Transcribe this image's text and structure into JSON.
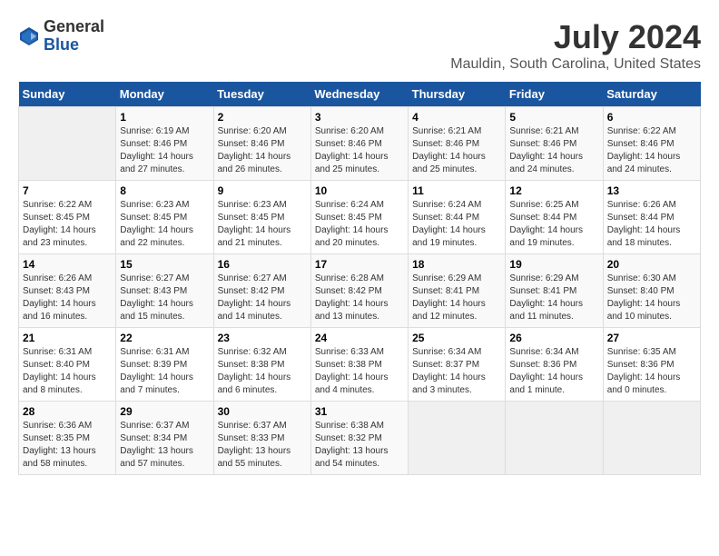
{
  "logo": {
    "general": "General",
    "blue": "Blue"
  },
  "title": "July 2024",
  "location": "Mauldin, South Carolina, United States",
  "days_of_week": [
    "Sunday",
    "Monday",
    "Tuesday",
    "Wednesday",
    "Thursday",
    "Friday",
    "Saturday"
  ],
  "weeks": [
    [
      {
        "day": "",
        "info": ""
      },
      {
        "day": "1",
        "info": "Sunrise: 6:19 AM\nSunset: 8:46 PM\nDaylight: 14 hours\nand 27 minutes."
      },
      {
        "day": "2",
        "info": "Sunrise: 6:20 AM\nSunset: 8:46 PM\nDaylight: 14 hours\nand 26 minutes."
      },
      {
        "day": "3",
        "info": "Sunrise: 6:20 AM\nSunset: 8:46 PM\nDaylight: 14 hours\nand 25 minutes."
      },
      {
        "day": "4",
        "info": "Sunrise: 6:21 AM\nSunset: 8:46 PM\nDaylight: 14 hours\nand 25 minutes."
      },
      {
        "day": "5",
        "info": "Sunrise: 6:21 AM\nSunset: 8:46 PM\nDaylight: 14 hours\nand 24 minutes."
      },
      {
        "day": "6",
        "info": "Sunrise: 6:22 AM\nSunset: 8:46 PM\nDaylight: 14 hours\nand 24 minutes."
      }
    ],
    [
      {
        "day": "7",
        "info": "Sunrise: 6:22 AM\nSunset: 8:45 PM\nDaylight: 14 hours\nand 23 minutes."
      },
      {
        "day": "8",
        "info": "Sunrise: 6:23 AM\nSunset: 8:45 PM\nDaylight: 14 hours\nand 22 minutes."
      },
      {
        "day": "9",
        "info": "Sunrise: 6:23 AM\nSunset: 8:45 PM\nDaylight: 14 hours\nand 21 minutes."
      },
      {
        "day": "10",
        "info": "Sunrise: 6:24 AM\nSunset: 8:45 PM\nDaylight: 14 hours\nand 20 minutes."
      },
      {
        "day": "11",
        "info": "Sunrise: 6:24 AM\nSunset: 8:44 PM\nDaylight: 14 hours\nand 19 minutes."
      },
      {
        "day": "12",
        "info": "Sunrise: 6:25 AM\nSunset: 8:44 PM\nDaylight: 14 hours\nand 19 minutes."
      },
      {
        "day": "13",
        "info": "Sunrise: 6:26 AM\nSunset: 8:44 PM\nDaylight: 14 hours\nand 18 minutes."
      }
    ],
    [
      {
        "day": "14",
        "info": "Sunrise: 6:26 AM\nSunset: 8:43 PM\nDaylight: 14 hours\nand 16 minutes."
      },
      {
        "day": "15",
        "info": "Sunrise: 6:27 AM\nSunset: 8:43 PM\nDaylight: 14 hours\nand 15 minutes."
      },
      {
        "day": "16",
        "info": "Sunrise: 6:27 AM\nSunset: 8:42 PM\nDaylight: 14 hours\nand 14 minutes."
      },
      {
        "day": "17",
        "info": "Sunrise: 6:28 AM\nSunset: 8:42 PM\nDaylight: 14 hours\nand 13 minutes."
      },
      {
        "day": "18",
        "info": "Sunrise: 6:29 AM\nSunset: 8:41 PM\nDaylight: 14 hours\nand 12 minutes."
      },
      {
        "day": "19",
        "info": "Sunrise: 6:29 AM\nSunset: 8:41 PM\nDaylight: 14 hours\nand 11 minutes."
      },
      {
        "day": "20",
        "info": "Sunrise: 6:30 AM\nSunset: 8:40 PM\nDaylight: 14 hours\nand 10 minutes."
      }
    ],
    [
      {
        "day": "21",
        "info": "Sunrise: 6:31 AM\nSunset: 8:40 PM\nDaylight: 14 hours\nand 8 minutes."
      },
      {
        "day": "22",
        "info": "Sunrise: 6:31 AM\nSunset: 8:39 PM\nDaylight: 14 hours\nand 7 minutes."
      },
      {
        "day": "23",
        "info": "Sunrise: 6:32 AM\nSunset: 8:38 PM\nDaylight: 14 hours\nand 6 minutes."
      },
      {
        "day": "24",
        "info": "Sunrise: 6:33 AM\nSunset: 8:38 PM\nDaylight: 14 hours\nand 4 minutes."
      },
      {
        "day": "25",
        "info": "Sunrise: 6:34 AM\nSunset: 8:37 PM\nDaylight: 14 hours\nand 3 minutes."
      },
      {
        "day": "26",
        "info": "Sunrise: 6:34 AM\nSunset: 8:36 PM\nDaylight: 14 hours\nand 1 minute."
      },
      {
        "day": "27",
        "info": "Sunrise: 6:35 AM\nSunset: 8:36 PM\nDaylight: 14 hours\nand 0 minutes."
      }
    ],
    [
      {
        "day": "28",
        "info": "Sunrise: 6:36 AM\nSunset: 8:35 PM\nDaylight: 13 hours\nand 58 minutes."
      },
      {
        "day": "29",
        "info": "Sunrise: 6:37 AM\nSunset: 8:34 PM\nDaylight: 13 hours\nand 57 minutes."
      },
      {
        "day": "30",
        "info": "Sunrise: 6:37 AM\nSunset: 8:33 PM\nDaylight: 13 hours\nand 55 minutes."
      },
      {
        "day": "31",
        "info": "Sunrise: 6:38 AM\nSunset: 8:32 PM\nDaylight: 13 hours\nand 54 minutes."
      },
      {
        "day": "",
        "info": ""
      },
      {
        "day": "",
        "info": ""
      },
      {
        "day": "",
        "info": ""
      }
    ]
  ]
}
